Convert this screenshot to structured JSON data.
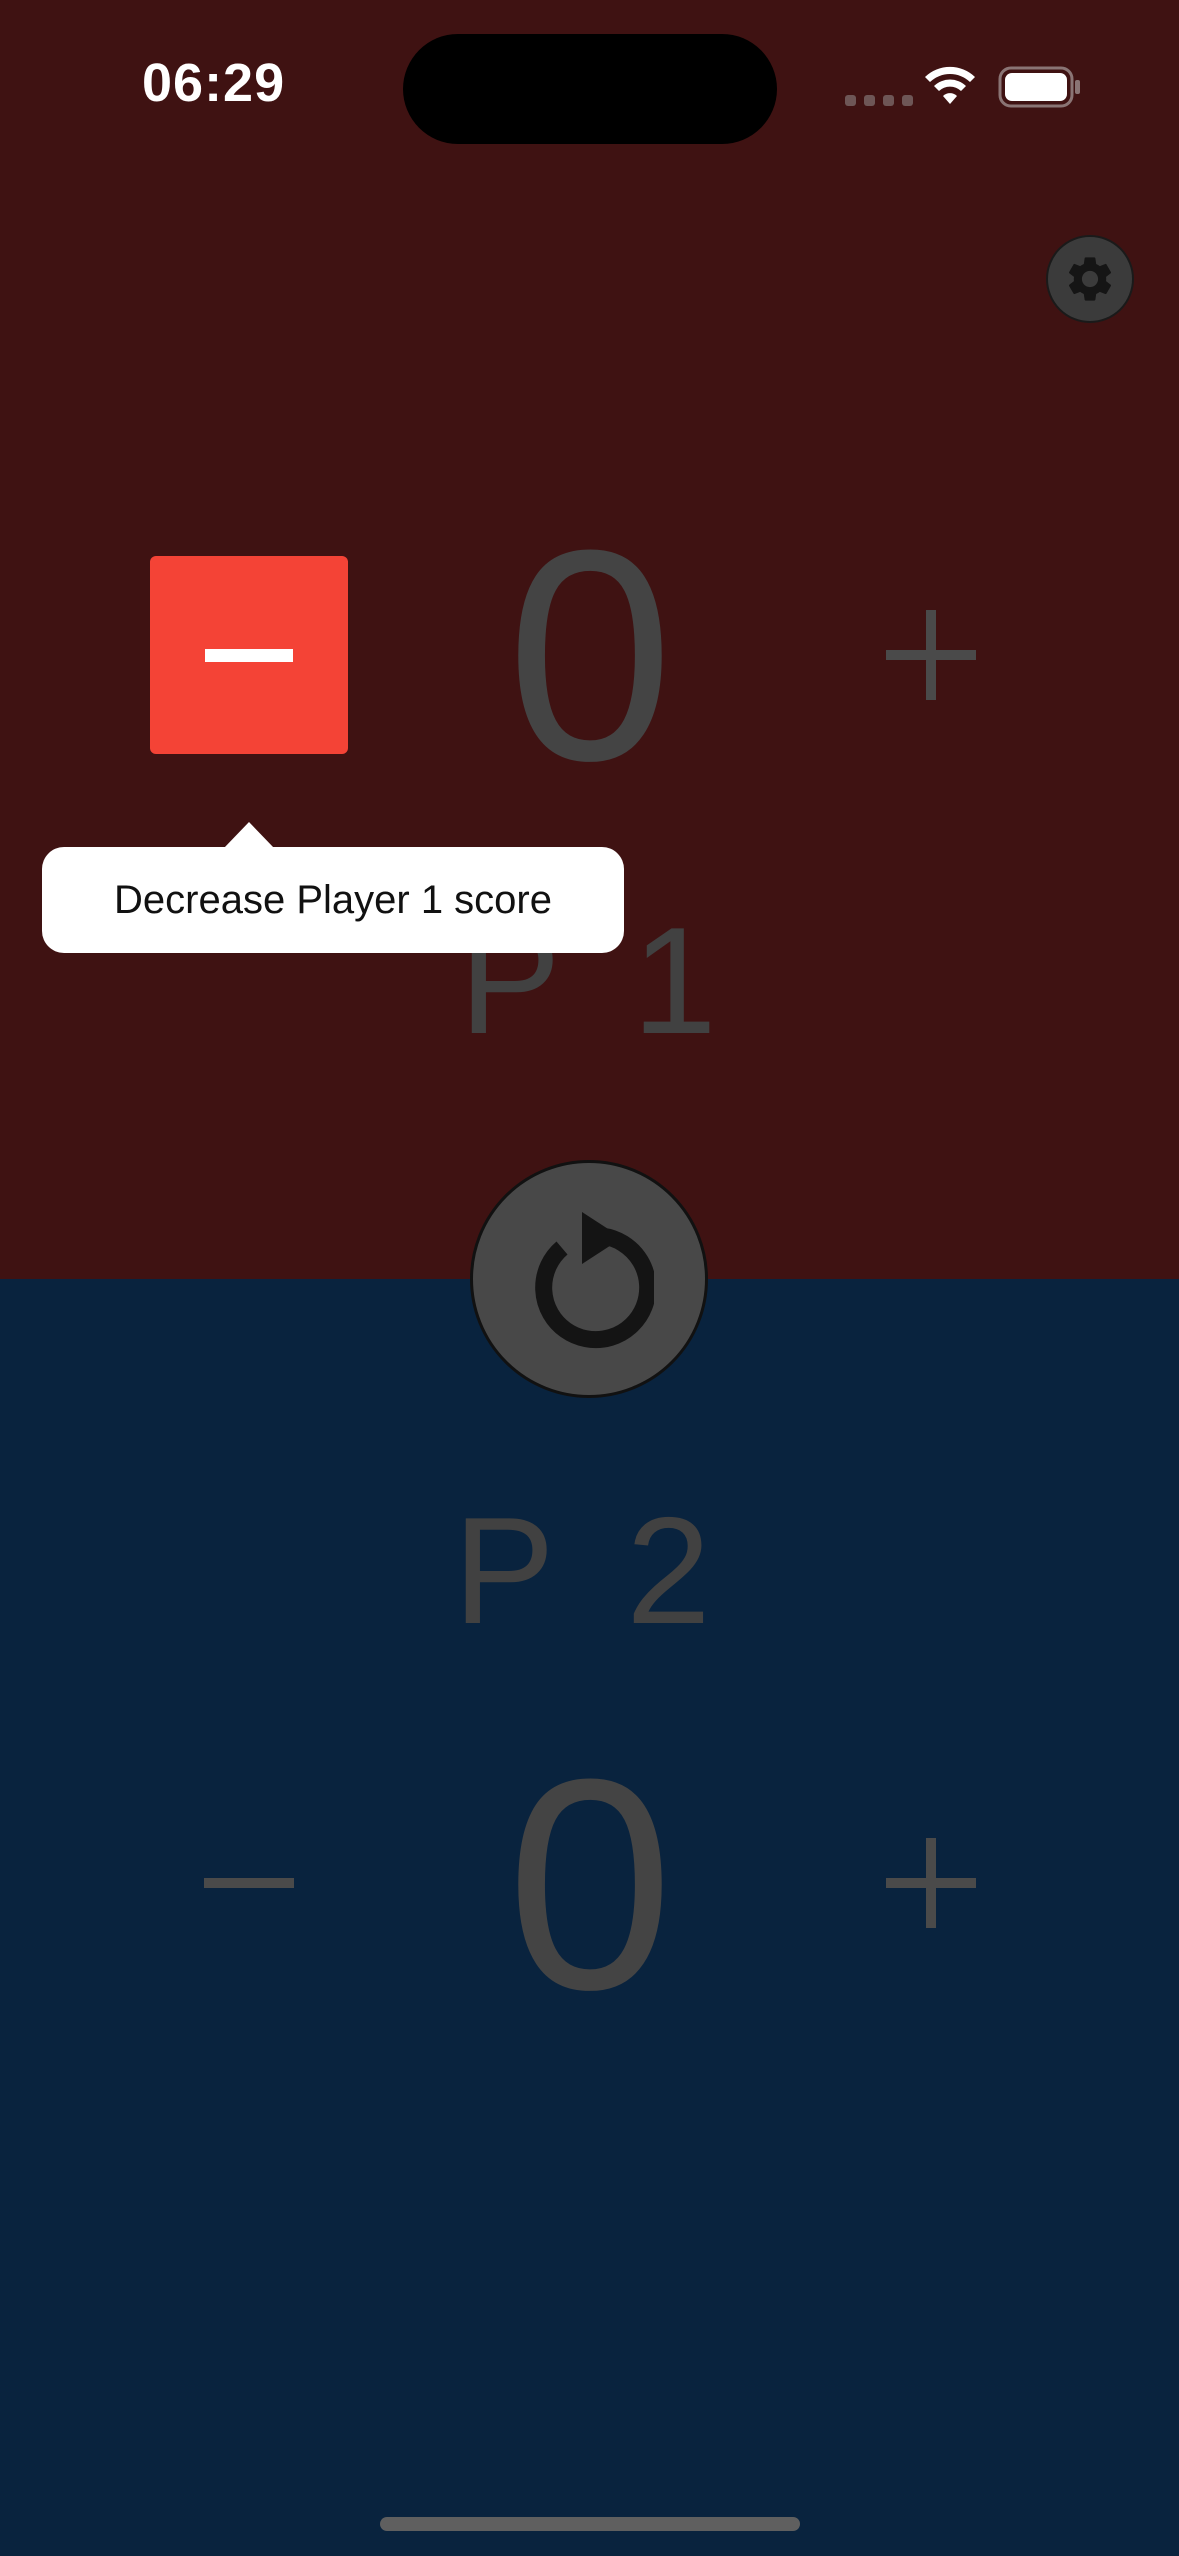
{
  "status_bar": {
    "time": "06:29"
  },
  "colors": {
    "player1_background": "#3f1212",
    "player2_background": "#09233e",
    "pressed_button": "#f44336"
  },
  "icons": {
    "settings": "gear-icon",
    "reset": "reset-icon",
    "wifi": "wifi-icon",
    "battery": "battery-icon"
  },
  "player1": {
    "label": "P 1",
    "score": "0"
  },
  "player2": {
    "label": "P 2",
    "score": "0"
  },
  "tooltip": {
    "text": "Decrease Player 1 score"
  }
}
